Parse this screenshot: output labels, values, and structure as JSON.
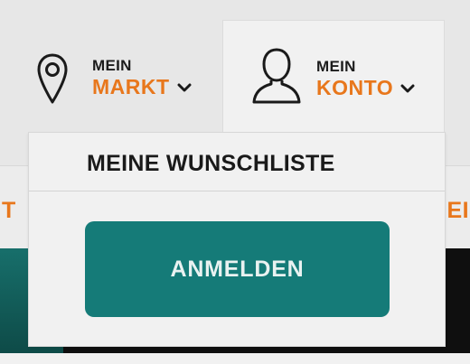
{
  "header": {
    "market": {
      "line1": "MEIN",
      "line2": "MARKT",
      "icon": "map-pin-icon"
    },
    "account": {
      "line1": "MEIN",
      "line2": "KONTO",
      "icon": "user-icon"
    }
  },
  "nav": {
    "left_fragment": "T",
    "right_fragment": "IEI"
  },
  "dropdown": {
    "wishlist_label": "MEINE WUNSCHLISTE",
    "login_label": "ANMELDEN"
  },
  "colors": {
    "accent_orange": "#e8771c",
    "button_teal": "#157b78",
    "text_dark": "#1a1a1a",
    "header_bg": "#e7e7e7",
    "dropdown_bg": "#f1f1f1"
  }
}
